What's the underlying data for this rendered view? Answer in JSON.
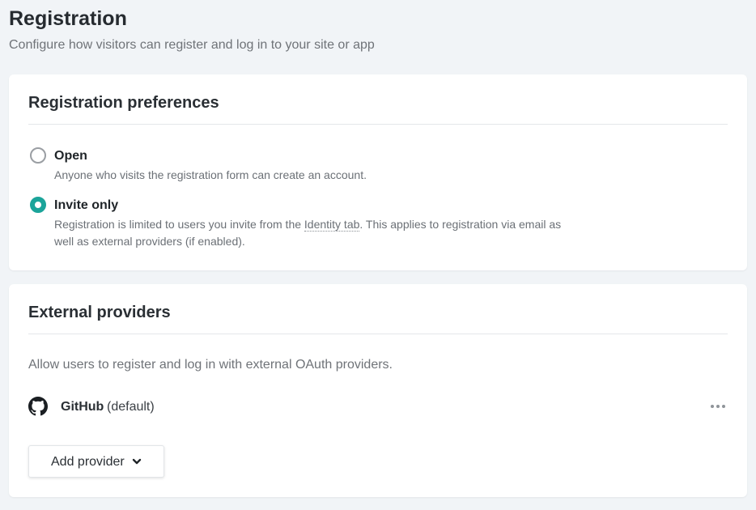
{
  "header": {
    "title": "Registration",
    "subtitle": "Configure how visitors can register and log in to your site or app"
  },
  "registration_preferences": {
    "title": "Registration preferences",
    "options": [
      {
        "label": "Open",
        "description": "Anyone who visits the registration form can create an account.",
        "selected": false
      },
      {
        "label": "Invite only",
        "description_before": "Registration is limited to users you invite from the ",
        "link_text": "Identity tab",
        "description_after": ". This applies to registration via email as well as external providers (if enabled).",
        "selected": true
      }
    ]
  },
  "external_providers": {
    "title": "External providers",
    "description": "Allow users to register and log in with external OAuth providers.",
    "providers": [
      {
        "icon": "github-icon",
        "name": "GitHub",
        "tag": "(default)"
      }
    ],
    "add_button_label": "Add provider"
  },
  "colors": {
    "accent": "#1ba49a",
    "background": "#f1f4f7"
  }
}
